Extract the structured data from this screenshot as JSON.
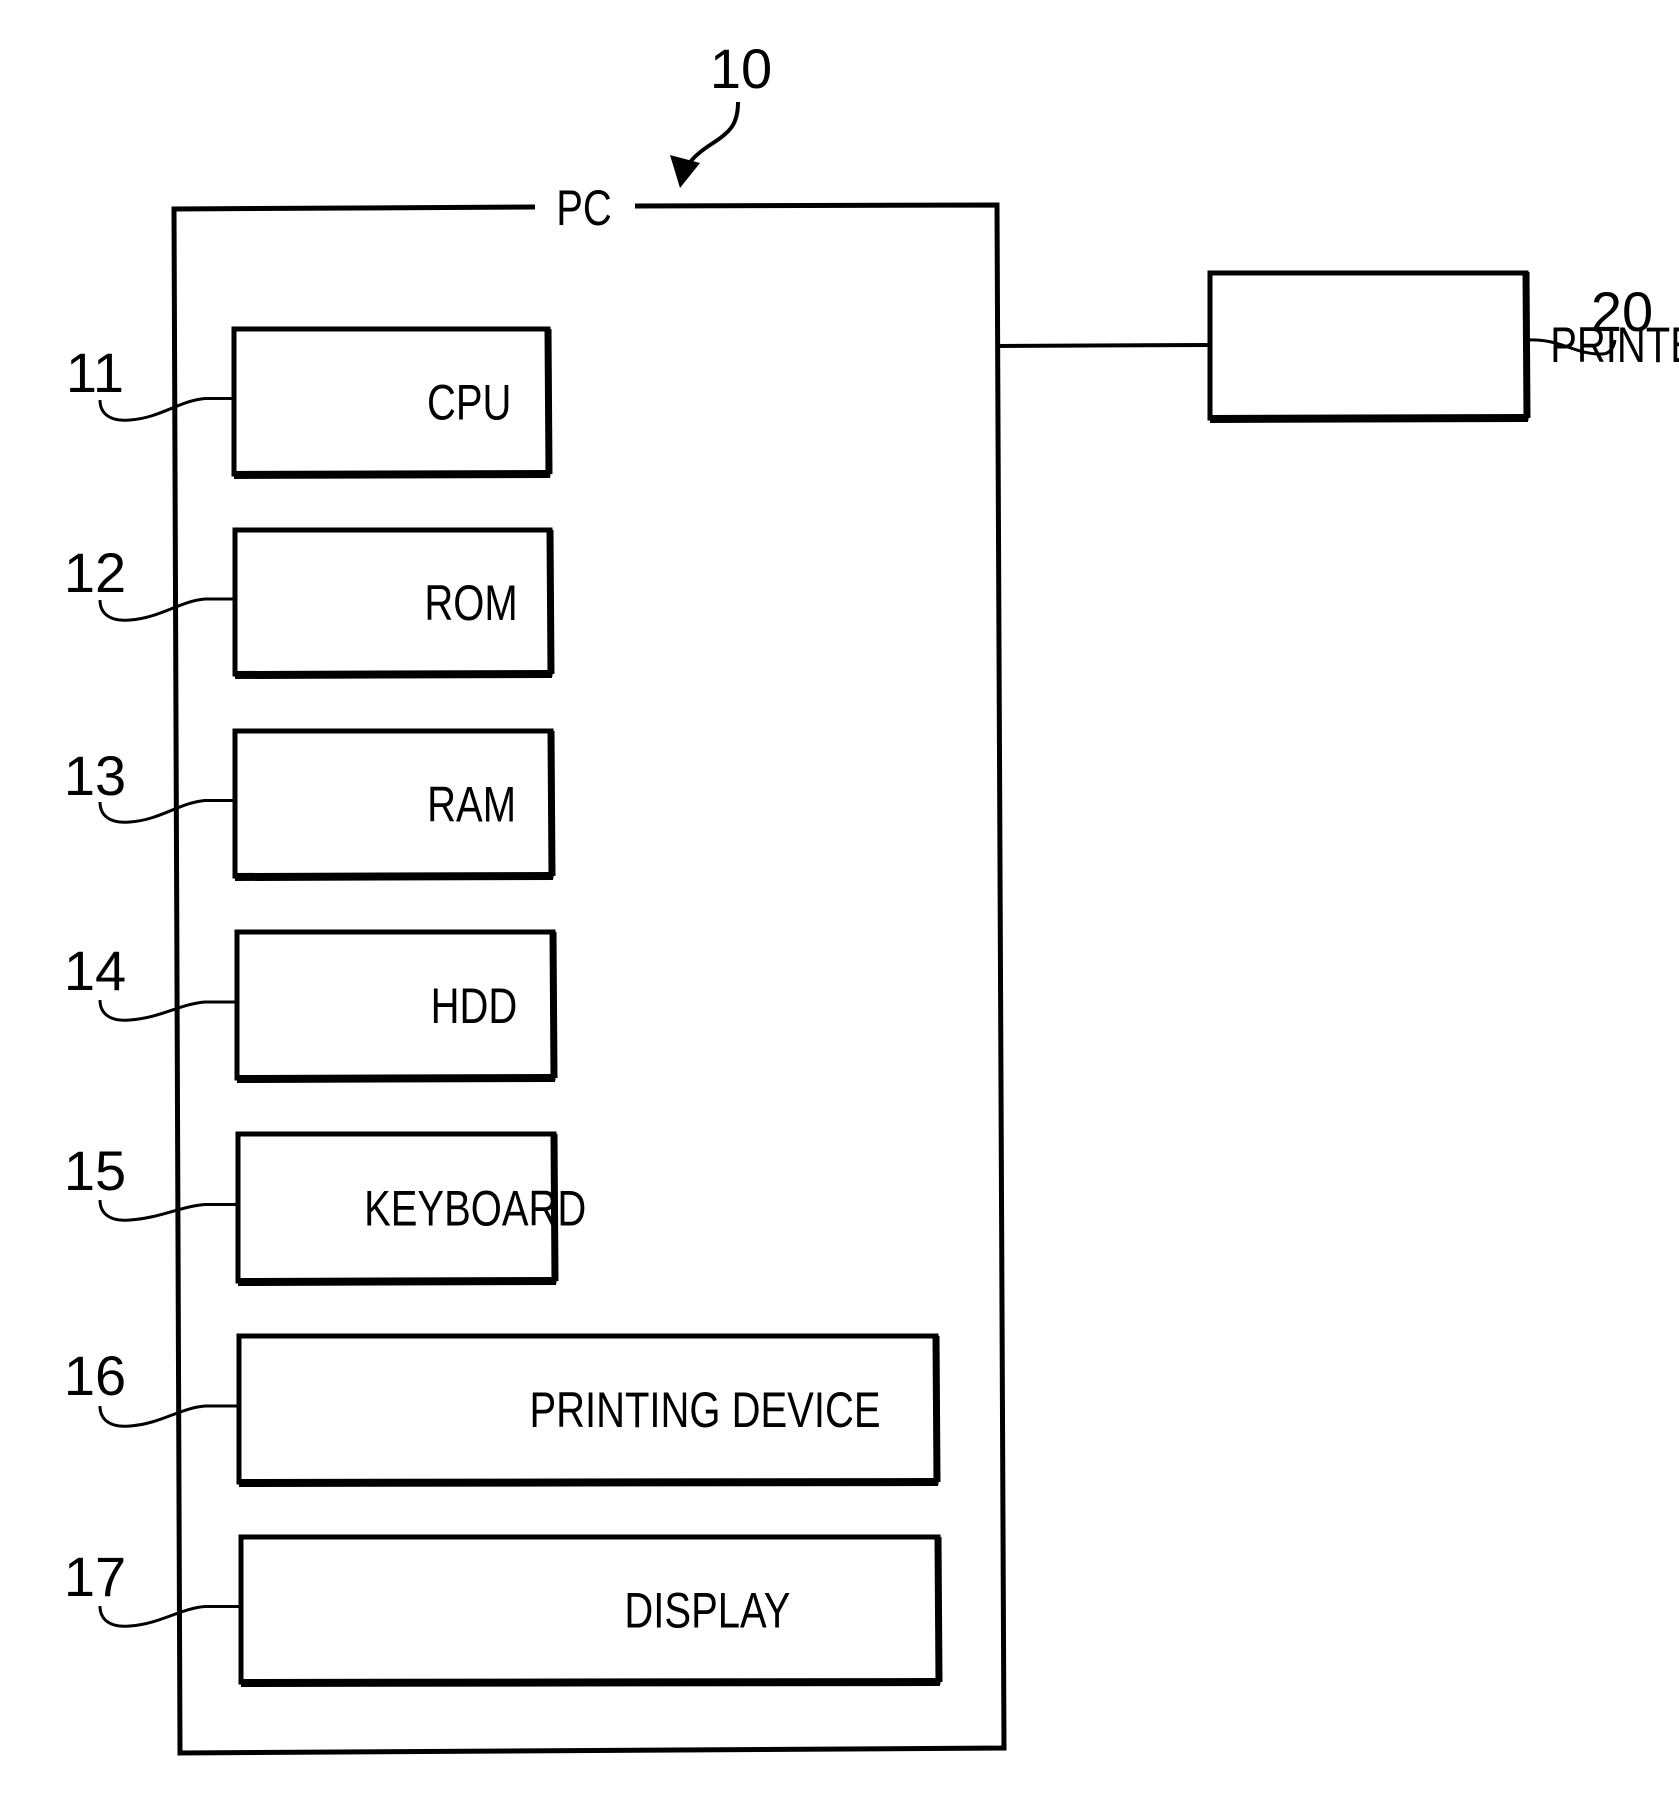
{
  "diagram": {
    "system": {
      "ref": "10",
      "label": "PC"
    },
    "components": [
      {
        "ref": "11",
        "label": "CPU"
      },
      {
        "ref": "12",
        "label": "ROM"
      },
      {
        "ref": "13",
        "label": "RAM"
      },
      {
        "ref": "14",
        "label": "HDD"
      },
      {
        "ref": "15",
        "label": "KEYBOARD"
      },
      {
        "ref": "16",
        "label": "PRINTING DEVICE"
      },
      {
        "ref": "17",
        "label": "DISPLAY"
      }
    ],
    "external": {
      "ref": "20",
      "label": "PRINTER"
    },
    "connections": [
      {
        "from": "PC",
        "to": "PRINTER"
      }
    ],
    "colors": {
      "ink": "#000000",
      "paper": "#ffffff"
    }
  }
}
